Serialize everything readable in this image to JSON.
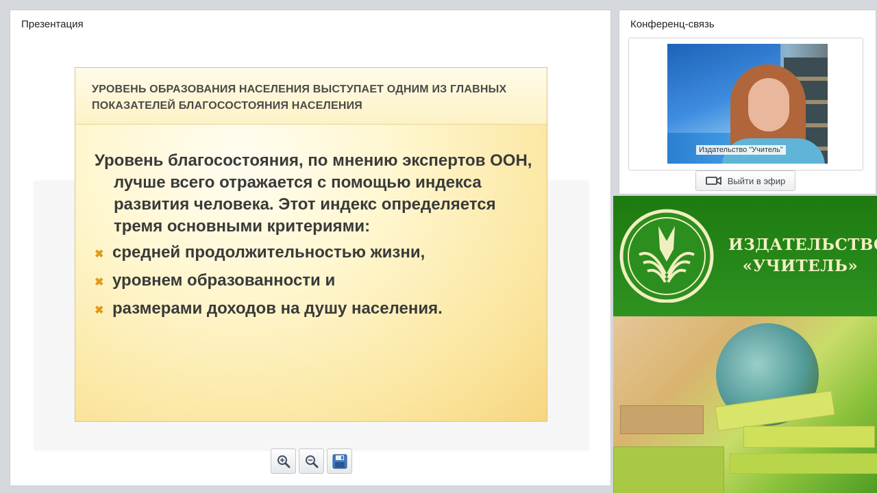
{
  "presentation": {
    "title": "Презентация",
    "slide": {
      "heading": "Уровень образования населения выступает одним из главных показателей благосостояния населения",
      "lead": "Уровень благосостояния, по мнению экспертов ООН, лучше всего отражается с помощью индекса развития человека. Этот индекс определяется тремя основными критериями:",
      "bullets": [
        "средней продолжительностью жизни,",
        "уровнем образованности и",
        "размерами доходов на душу населения."
      ],
      "bullet_icon": "cross-bullet-icon"
    },
    "toolbar": {
      "zoom_in_icon": "zoom-in-icon",
      "zoom_out_icon": "zoom-out-icon",
      "save_icon": "floppy-disk-icon"
    }
  },
  "conference": {
    "title": "Конференц-связь",
    "video_caption": "Издательство \"Учитель\"",
    "onair_label": "Выйти в эфир",
    "onair_icon": "camera-icon"
  },
  "publisher": {
    "name_line1": "ИЗДАТЕЛЬСТВО",
    "name_line2": "«УЧИТЕЛЬ»"
  },
  "colors": {
    "slide_bg": "#fff7d0",
    "bullet": "#e09a1a",
    "banner_green": "#2a8a1a",
    "banner_text": "#f3f0c4"
  }
}
